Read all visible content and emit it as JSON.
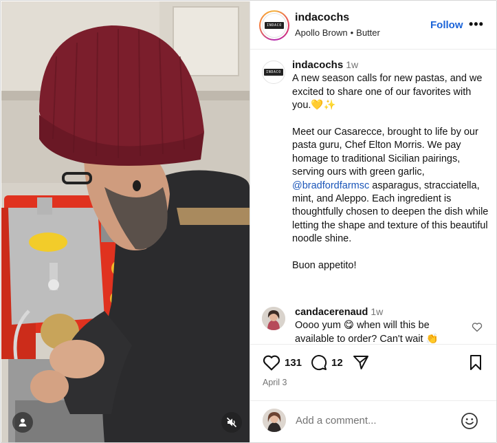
{
  "post": {
    "username": "indacochs",
    "logo_text": "INDACO",
    "audio": {
      "artist": "Apollo Brown",
      "separator": "•",
      "track": "Butter"
    },
    "follow_label": "Follow",
    "more_label": "•••"
  },
  "caption": {
    "username": "indacochs",
    "time": "1w",
    "paragraphs": [
      "A new season calls for new pastas, and we excited to share one of our favorites with you.💛✨",
      "Meet our Casarecce, brought to life by our pasta guru, Chef Elton Morris. We pay homage to traditional Sicilian pairings, serving ours with green garlic,",
      "@bradfordfarmsc",
      "asparagus, stracciatella, mint, and Aleppo. Each ingredient is thoughtfully chosen to deepen the dish while letting the shape and texture of this beautiful noodle shine.",
      "Buon appetito!"
    ]
  },
  "comment": {
    "username": "candacerenaud",
    "time": "1w",
    "text": "Oooo yum 😋 when will this be available to order? Can't wait 👏"
  },
  "actions": {
    "likes": "131",
    "comments": "12",
    "date": "April 3"
  },
  "add_comment": {
    "placeholder": "Add a comment..."
  },
  "icons": {
    "media_user": "user-icon",
    "media_mute": "speaker-muted-icon",
    "like": "heart-icon",
    "comment": "comment-bubble-icon",
    "share": "paper-plane-icon",
    "save": "bookmark-icon",
    "emoji": "smiley-icon",
    "comment_like": "heart-outline-icon"
  },
  "colors": {
    "link_blue": "#1a63d8",
    "mention_blue": "#1a55b8",
    "secondary_text": "#737373",
    "beanie": "#7b1e2c"
  }
}
